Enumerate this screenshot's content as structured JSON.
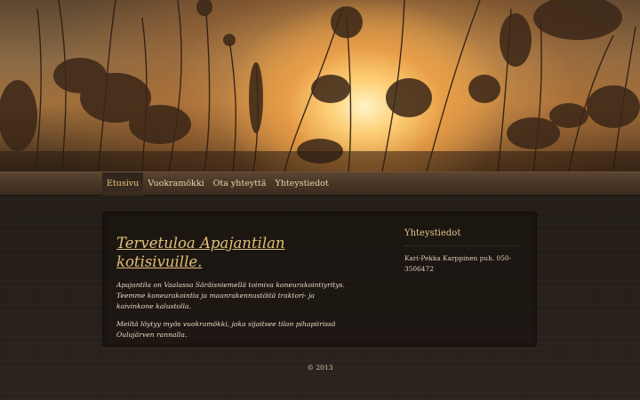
{
  "nav": {
    "items": [
      {
        "label": "Etusivu",
        "active": true
      },
      {
        "label": "Vuokramökki",
        "active": false
      },
      {
        "label": "Ota yhteyttä",
        "active": false
      },
      {
        "label": "Yhteystiedot",
        "active": false
      }
    ]
  },
  "main": {
    "title": "Tervetuloa Apajantilan kotisivuille.",
    "paragraphs": [
      "Apajantila on Vaalassa Säräisniemellä toimiva koneurakointiyritys. Teemme koneurakointia ja maanrakennustöitä traktori- ja kaivinkone kalustolla.",
      "Meiltä löytyy myös vuokramökki, joka sijaitsee tilan pihapiirissä Oulujärven rannalla."
    ]
  },
  "sidebar": {
    "title": "Yhteystiedot",
    "text": "Kari-Pekka Karppinen puh. 050-3506472"
  },
  "footer": {
    "text": "© 2013"
  },
  "colors": {
    "accent": "#e2bf78",
    "nav_text": "#e8d6a8",
    "background": "#2a231d"
  }
}
